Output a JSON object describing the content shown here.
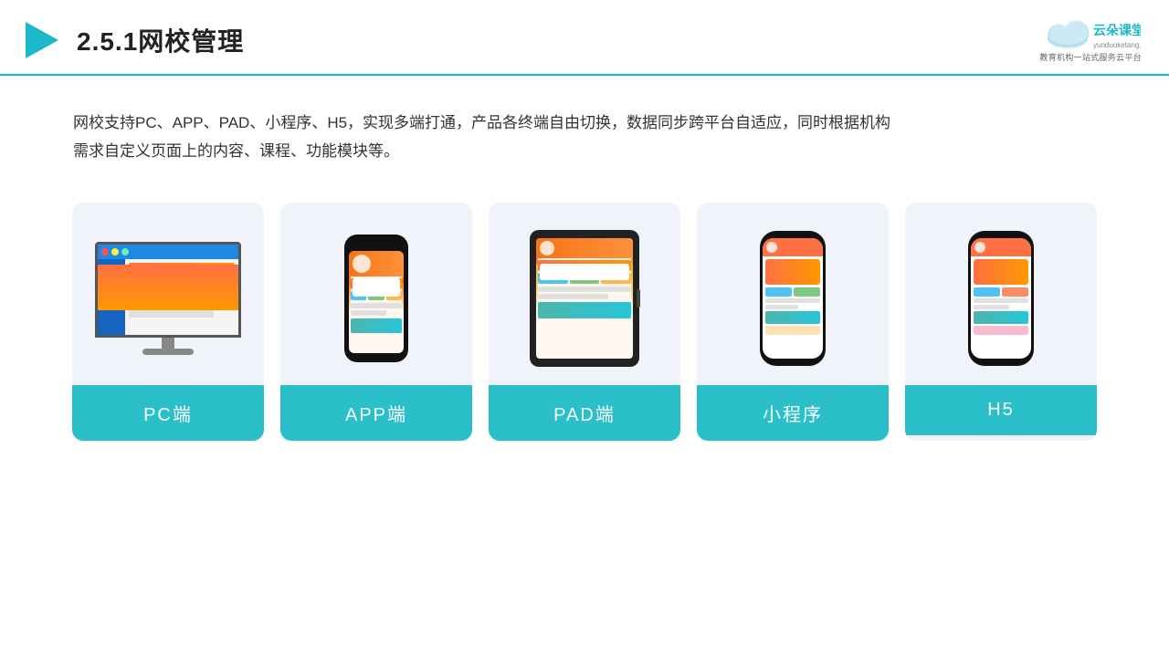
{
  "header": {
    "title": "2.5.1网校管理",
    "title_num": "2.5.1",
    "title_text": "网校管理",
    "logo_name": "云朵课堂",
    "logo_sub": "yunduoketang.com",
    "logo_tag": "教育机构一站式服务云平台"
  },
  "description": {
    "text1": "网校支持PC、APP、PAD、小程序、H5，实现多端打通，产品各终端自由切换，数据同步跨平台自适应，同时根据机构",
    "text2": "需求自定义页面上的内容、课程、功能模块等。"
  },
  "cards": [
    {
      "id": "pc",
      "label": "PC端"
    },
    {
      "id": "app",
      "label": "APP端"
    },
    {
      "id": "pad",
      "label": "PAD端"
    },
    {
      "id": "miniprogram",
      "label": "小程序"
    },
    {
      "id": "h5",
      "label": "H5"
    }
  ]
}
